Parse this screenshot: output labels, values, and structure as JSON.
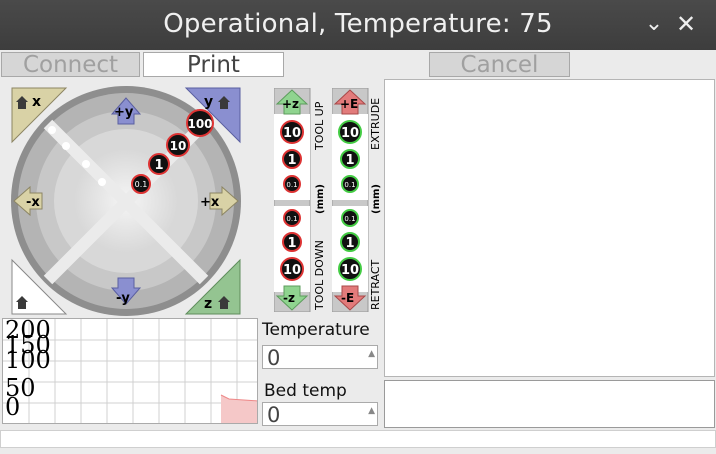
{
  "window": {
    "title": "Operational, Temperature: 75",
    "minimize_glyph": "⌄",
    "close_glyph": "✕"
  },
  "toolbar": {
    "connect_label": "Connect",
    "print_label": "Print",
    "cancel_label": "Cancel"
  },
  "xy_jog": {
    "home_x": "x",
    "home_y": "y",
    "home_z": "z",
    "plus_y": "+y",
    "minus_y": "-y",
    "minus_x": "-x",
    "plus_x": "+x",
    "steps": [
      "0.1",
      "1",
      "10",
      "100"
    ]
  },
  "z_jog": {
    "plus_z": "+z",
    "minus_z": "-z",
    "up_steps": [
      "10",
      "1",
      "0.1"
    ],
    "down_steps": [
      "0.1",
      "1",
      "10"
    ],
    "label_up": "TOOL UP",
    "label_mm": "(mm)",
    "label_down": "TOOL DOWN"
  },
  "e_jog": {
    "plus_e": "+E",
    "minus_e": "-E",
    "up_steps": [
      "10",
      "1",
      "0.1"
    ],
    "down_steps": [
      "0.1",
      "1",
      "10"
    ],
    "label_extrude": "EXTRUDE",
    "label_mm": "(mm)",
    "label_retract": "RETRACT"
  },
  "temperature": {
    "label": "Temperature",
    "value": "0"
  },
  "bed": {
    "label": "Bed temp",
    "value": "0"
  },
  "graph": {
    "y_ticks": [
      "200",
      "150",
      "100",
      "50",
      "0"
    ]
  },
  "icons": {
    "home": "home-icon",
    "up": "arrow-up-icon",
    "down": "arrow-down-icon",
    "left": "arrow-left-icon",
    "right": "arrow-right-icon"
  },
  "colors": {
    "titlebar": "#404040",
    "y_axis": "#8a8fd0",
    "x_axis": "#d9d2a6",
    "z_axis": "#94c491",
    "home_icon": "#3a3a3a",
    "up": "#8fd48f",
    "down_red": "#e27b7b"
  }
}
